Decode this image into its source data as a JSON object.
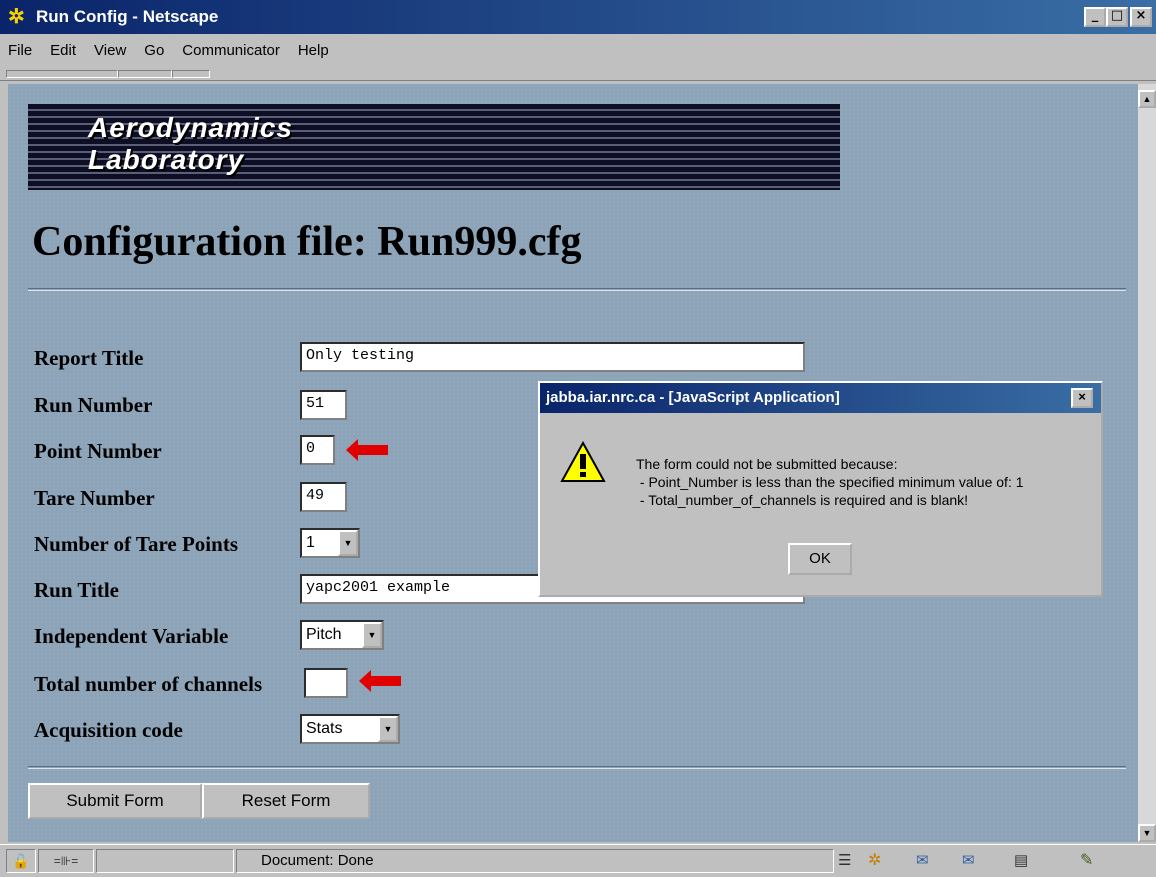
{
  "window": {
    "title": "Run Config - Netscape"
  },
  "menu": [
    "File",
    "Edit",
    "View",
    "Go",
    "Communicator",
    "Help"
  ],
  "page": {
    "logo_line1": "Aerodynamics",
    "logo_line2": "Laboratory",
    "heading": "Configuration file: Run999.cfg"
  },
  "form": {
    "report_title": {
      "label": "Report Title",
      "value": "Only testing"
    },
    "run_number": {
      "label": "Run Number",
      "value": "51"
    },
    "point_number": {
      "label": "Point Number",
      "value": "0"
    },
    "tare_number": {
      "label": "Tare Number",
      "value": "49"
    },
    "tare_points": {
      "label": "Number of Tare Points",
      "value": "1"
    },
    "run_title": {
      "label": "Run Title",
      "value": "yapc2001 example"
    },
    "independent_variable": {
      "label": "Independent Variable",
      "value": "Pitch"
    },
    "total_channels": {
      "label": "Total number of channels",
      "value": ""
    },
    "acquisition_code": {
      "label": "Acquisition code",
      "value": "Stats"
    },
    "submit_label": "Submit Form",
    "reset_label": "Reset Form"
  },
  "dialog": {
    "title": "jabba.iar.nrc.ca - [JavaScript Application]",
    "line1": "The form could not be submitted because:",
    "line2": " - Point_Number is less than the specified minimum value of: 1",
    "line3": " - Total_number_of_channels is required and is blank!",
    "ok_label": "OK"
  },
  "status": {
    "text": "Document: Done"
  },
  "colors": {
    "page_bg": "#8da3b8",
    "arrow": "#e00000"
  }
}
